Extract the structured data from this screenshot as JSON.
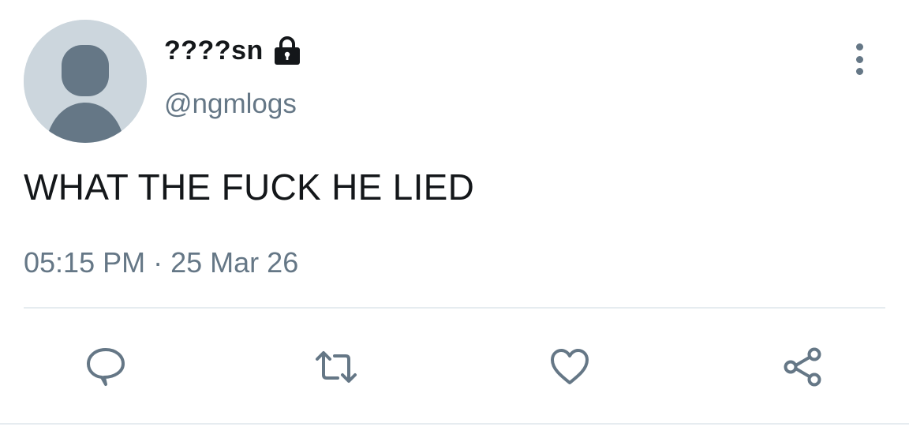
{
  "tweet": {
    "display_name": "????sn",
    "handle": "@ngmlogs",
    "text": "WHAT THE FUCK HE LIED",
    "time": "05:15 PM",
    "separator": "·",
    "date": "25 Mar 26",
    "protected_icon": "lock-icon",
    "avatar_icon": "default-profile-avatar",
    "more_icon": "vertical-ellipsis-icon"
  },
  "actions": [
    {
      "name": "reply",
      "icon": "speech-bubble-icon"
    },
    {
      "name": "retweet",
      "icon": "retweet-arrows-icon"
    },
    {
      "name": "like",
      "icon": "heart-icon"
    },
    {
      "name": "share",
      "icon": "share-nodes-icon"
    }
  ],
  "colors": {
    "text_primary": "#14171a",
    "text_secondary": "#657786",
    "avatar_bg": "#ccd6dd",
    "avatar_fg": "#657786",
    "divider": "#e6ecf0"
  }
}
